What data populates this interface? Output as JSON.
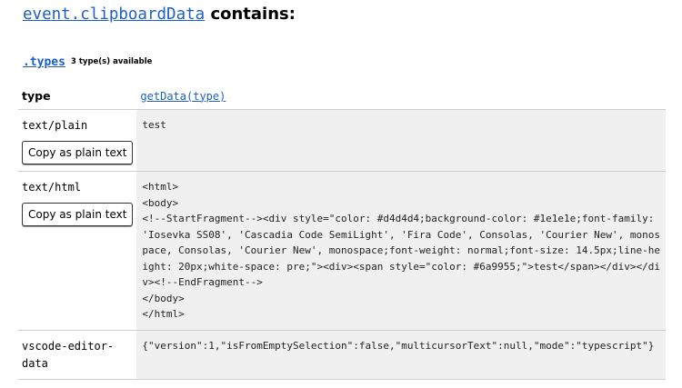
{
  "heading": {
    "link": "event.clipboardData",
    "suffix": " contains:"
  },
  "types_section": {
    "link": ".types",
    "count": "3 type(s) available"
  },
  "table": {
    "headers": {
      "type": "type",
      "data": "getData(type)"
    },
    "copy_label": "Copy as plain text",
    "rows": [
      {
        "type": "text/plain",
        "value": "test"
      },
      {
        "type": "text/html",
        "value": "<html>\n<body>\n<!--StartFragment--><div style=\"color: #d4d4d4;background-color: #1e1e1e;font-family:  'Iosevka SS08', 'Cascadia Code SemiLight', 'Fira Code', Consolas, 'Courier New', monospace, Consolas, 'Courier New', monospace;font-weight: normal;font-size: 14.5px;line-height: 20px;white-space: pre;\"><div><span style=\"color: #6a9955;\">test</span></div></div><!--EndFragment-->\n</body>\n</html>"
      },
      {
        "type": "vscode-editor-data",
        "value": "{\"version\":1,\"isFromEmptySelection\":false,\"multicursorText\":null,\"mode\":\"typescript\"}"
      }
    ]
  }
}
